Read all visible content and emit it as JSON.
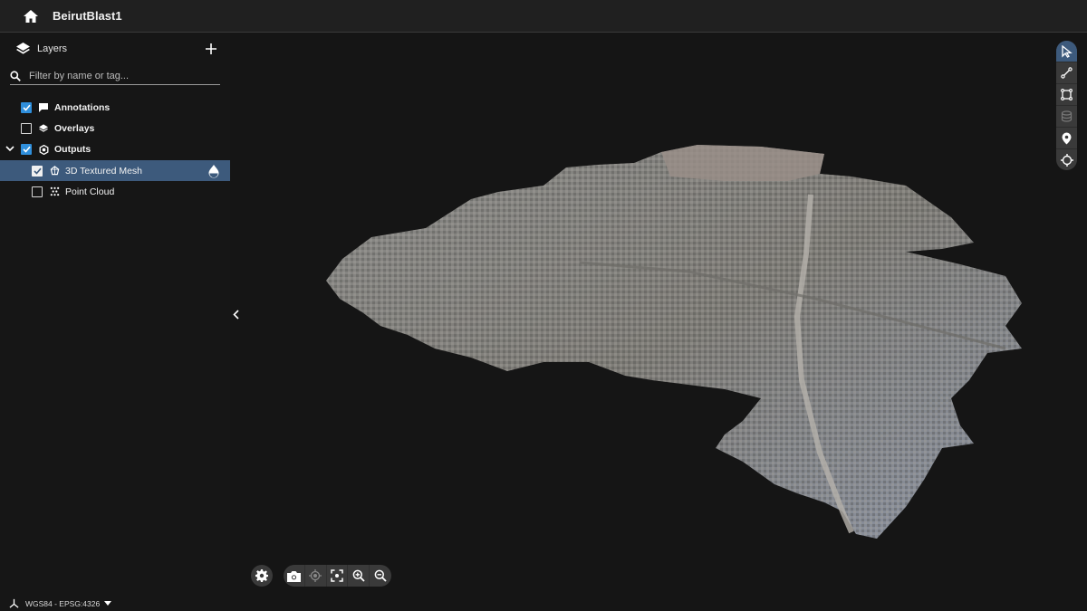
{
  "header": {
    "title": "BeirutBlast1",
    "home_icon": "home-icon"
  },
  "sidebar": {
    "title": "Layers",
    "add_icon": "plus-icon",
    "filter": {
      "value": "",
      "placeholder": "Filter by name or tag..."
    },
    "layers": [
      {
        "label": "Annotations",
        "checked": true,
        "icon": "comment-icon",
        "bold": true
      },
      {
        "label": "Overlays",
        "checked": false,
        "icon": "layers-icon",
        "bold": true
      },
      {
        "label": "Outputs",
        "checked": true,
        "icon": "hexagon-icon",
        "bold": true,
        "expanded": true,
        "children": [
          {
            "label": "3D Textured Mesh",
            "checked": true,
            "icon": "mesh-icon",
            "selected": true,
            "action_icon": "drop-icon"
          },
          {
            "label": "Point Cloud",
            "checked": false,
            "icon": "point-cloud-icon"
          }
        ]
      }
    ]
  },
  "viewport": {
    "scene": "3D textured mesh of Beirut city and port",
    "right_toolbar": [
      {
        "name": "select",
        "icon": "cursor-icon",
        "active": true
      },
      {
        "name": "measure-line",
        "icon": "line-icon"
      },
      {
        "name": "measure-area",
        "icon": "polygon-icon"
      },
      {
        "name": "measure-volume",
        "icon": "volume-icon",
        "disabled": true
      },
      {
        "name": "add-marker",
        "icon": "map-pin-icon"
      },
      {
        "name": "locate",
        "icon": "crosshair-icon"
      }
    ],
    "bottom_controls": [
      {
        "name": "screenshot",
        "icon": "camera-icon"
      },
      {
        "name": "my-location",
        "icon": "target-icon",
        "disabled": true
      },
      {
        "name": "zoom-to-fit",
        "icon": "focus-icon"
      },
      {
        "name": "zoom-in",
        "icon": "zoom-in-icon"
      },
      {
        "name": "zoom-out",
        "icon": "zoom-out-icon"
      }
    ],
    "settings_icon": "gear-icon"
  },
  "footer": {
    "crs_label": "WGS84 - EPSG:4326"
  },
  "colors": {
    "accent": "#2f8fdc",
    "selected_row": "#3d5a7c",
    "header_bg": "#202020",
    "background": "#151515"
  }
}
